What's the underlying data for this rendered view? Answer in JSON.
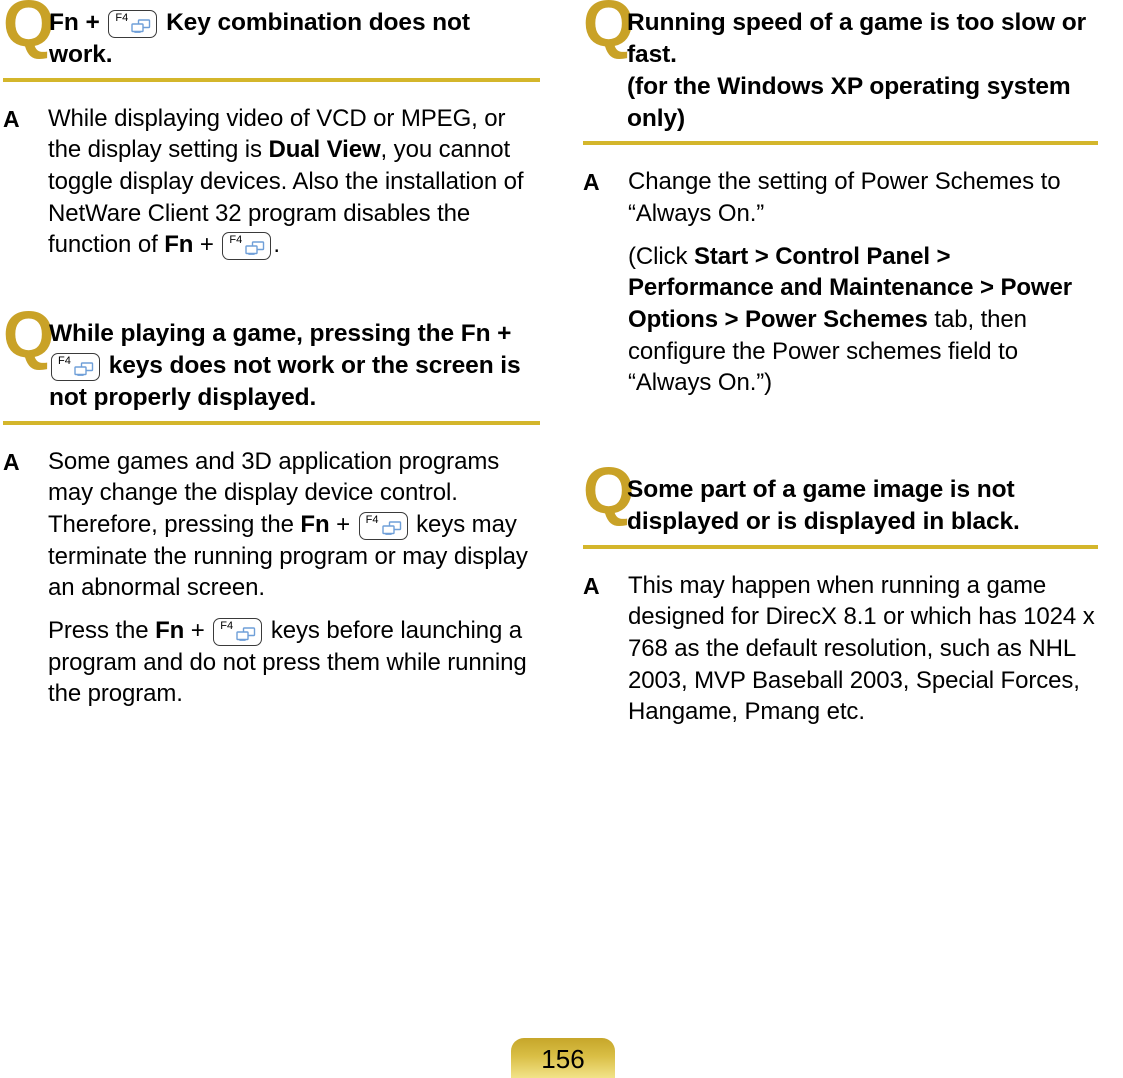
{
  "page": {
    "number": "156",
    "accent_color": "#D4B62B",
    "q_mark_color": "#C9A227",
    "q_letter": "Q",
    "a_letter": "A"
  },
  "key_icon": {
    "label": "F4",
    "icon_color": "#6F9FD8",
    "semantic": "display-toggle-key"
  },
  "left_column": {
    "entries": [
      {
        "q_parts": [
          {
            "type": "bold",
            "text": "Fn +"
          },
          {
            "type": "key"
          },
          {
            "type": "bold",
            "text": "Key combination does not work."
          }
        ],
        "a_paragraphs": [
          [
            {
              "type": "text",
              "text": "While displaying video of VCD or MPEG, or the display setting is "
            },
            {
              "type": "bold",
              "text": "Dual View"
            },
            {
              "type": "text",
              "text": ", you cannot toggle display devices. Also the installation of NetWare Client 32 program disables the function of "
            },
            {
              "type": "bold",
              "text": "Fn"
            },
            {
              "type": "text",
              "text": " + "
            },
            {
              "type": "key"
            },
            {
              "type": "text",
              "text": "."
            }
          ]
        ]
      },
      {
        "q_parts": [
          {
            "type": "bold",
            "text": "While playing a game, pressing the Fn +"
          },
          {
            "type": "key"
          },
          {
            "type": "bold",
            "text": "keys does not work or the screen is not properly displayed."
          }
        ],
        "a_paragraphs": [
          [
            {
              "type": "text",
              "text": "Some games and 3D application programs may change the display device control. Therefore, pressing the "
            },
            {
              "type": "bold",
              "text": "Fn"
            },
            {
              "type": "text",
              "text": " + "
            },
            {
              "type": "key"
            },
            {
              "type": "text",
              "text": " keys may terminate the running program or may display an abnormal screen."
            }
          ],
          [
            {
              "type": "text",
              "text": "Press the "
            },
            {
              "type": "bold",
              "text": "Fn"
            },
            {
              "type": "text",
              "text": " + "
            },
            {
              "type": "key"
            },
            {
              "type": "text",
              "text": " keys before launching a program and do not press them while running the program."
            }
          ]
        ]
      }
    ]
  },
  "right_column": {
    "entries": [
      {
        "q_parts": [
          {
            "type": "bold",
            "text": "Running speed of a game is too slow or fast."
          },
          {
            "type": "break"
          },
          {
            "type": "bold",
            "text": "(for the Windows XP operating system only)"
          }
        ],
        "a_paragraphs": [
          [
            {
              "type": "text",
              "text": "Change the setting of Power Schemes to “Always On.”"
            }
          ],
          [
            {
              "type": "text",
              "text": "(Click "
            },
            {
              "type": "bold",
              "text": "Start > Control Panel > Performance and Maintenance > Power Options > Power Schemes"
            },
            {
              "type": "text",
              "text": " tab, then configure the Power schemes field to “Always On.”)"
            }
          ]
        ]
      },
      {
        "q_parts": [
          {
            "type": "bold",
            "text": "Some part of a game image is not displayed or is displayed in black."
          }
        ],
        "a_paragraphs": [
          [
            {
              "type": "text",
              "text": "This may happen when running a game designed for DirecX 8.1 or which has 1024 x 768 as the default resolution, such as NHL 2003, MVP Baseball 2003, Special Forces, Hangame, Pmang etc."
            }
          ]
        ]
      }
    ]
  },
  "text": {
    "l1_q_a": "Fn +",
    "l1_q_b": "Key combination does not work.",
    "l1_a_1": "While displaying video of VCD or MPEG, or the display setting is ",
    "l1_a_bold1": "Dual View",
    "l1_a_2": ", you cannot toggle display devices. Also the installation of NetWare Client 32 program disables the function of ",
    "l1_a_bold2": "Fn",
    "l1_a_3": " + ",
    "l1_a_4": ".",
    "l2_q_a": "While playing a game, pressing the Fn +",
    "l2_q_b": "keys does not work or the screen is not properly displayed.",
    "l2_a_1": "Some games and 3D application programs may change the display device control. Therefore, pressing the ",
    "l2_a_bold1": "Fn",
    "l2_a_2": " + ",
    "l2_a_3": " keys may terminate the running program or may display an abnormal screen.",
    "l2_a_4": "Press the ",
    "l2_a_bold2": "Fn",
    "l2_a_5": " + ",
    "l2_a_6": " keys before launching a program and do not press them while running the program.",
    "r1_q_a": "Running speed of a game is too slow or fast.",
    "r1_q_b": "(for the Windows XP operating system only)",
    "r1_a_1": "Change the setting of Power Schemes to “Always On.”",
    "r1_a_2": "(Click ",
    "r1_a_bold": "Start > Control Panel > Performance and Maintenance > Power Options > Power Schemes",
    "r1_a_3": " tab, then configure the Power schemes field to “Always On.”)",
    "r2_q": "Some part of a game image is not displayed or is displayed in black.",
    "r2_a": "This may happen when running a game designed for DirecX 8.1 or which has 1024 x 768 as the default resolution, such as NHL 2003, MVP Baseball 2003, Special Forces, Hangame, Pmang etc."
  }
}
